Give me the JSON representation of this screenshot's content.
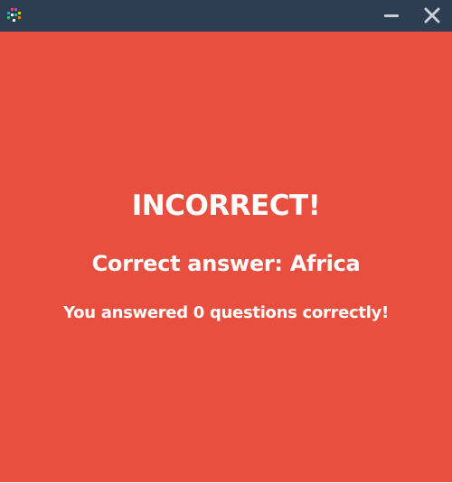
{
  "window": {
    "titlebar_color": "#2e3e52",
    "icon": "app-logo-icon",
    "controls": {
      "minimize_icon": "minimize-icon",
      "close_icon": "close-icon"
    }
  },
  "quiz_result": {
    "background_color": "#e94f3e",
    "status": "INCORRECT!",
    "correct_answer": "Correct answer: Africa",
    "score_message": "You answered 0 questions correctly!"
  }
}
